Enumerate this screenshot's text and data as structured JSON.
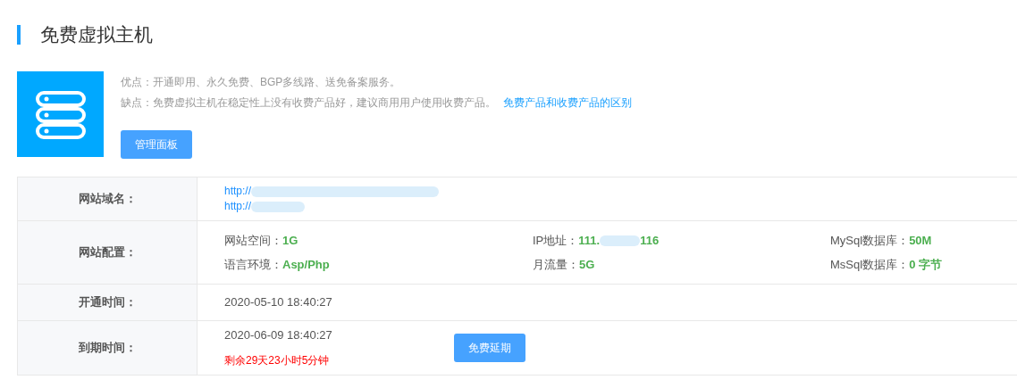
{
  "title": "免费虚拟主机",
  "pros": "优点：开通即用、永久免费、BGP多线路、送免备案服务。",
  "cons": "缺点：免费虚拟主机在稳定性上没有收费产品好，建议商用用户使用收费产品。",
  "compare_link": "免费产品和收费产品的区别",
  "panel_button": "管理面板",
  "domain": {
    "label": "网站域名：",
    "urls": [
      "http://",
      "http://"
    ]
  },
  "config": {
    "label": "网站配置：",
    "items": [
      {
        "name": "网站空间：",
        "value": [
          "1G"
        ]
      },
      {
        "name": "IP地址：",
        "value": [
          "111.",
          "116"
        ]
      },
      {
        "name": "MySql数据库：",
        "value": [
          "50M"
        ]
      },
      {
        "name": "语言环境：",
        "value": [
          "Asp/Php"
        ]
      },
      {
        "name": "月流量：",
        "value": [
          "5G"
        ]
      },
      {
        "name": "MsSql数据库：",
        "value": [
          "0 字节"
        ]
      }
    ]
  },
  "opened": {
    "label": "开通时间：",
    "time": "2020-05-10 18:40:27"
  },
  "expiry": {
    "label": "到期时间：",
    "time": "2020-06-09 18:40:27",
    "remaining": "剩余29天23小时5分钟",
    "button": "免费延期"
  }
}
